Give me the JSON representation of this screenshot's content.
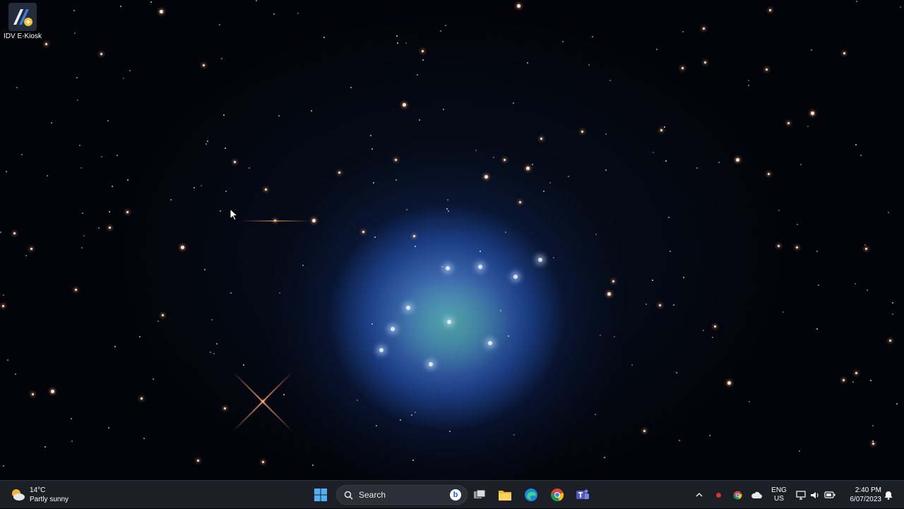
{
  "desktop": {
    "icons": [
      {
        "label": "IDV E-Kiosk",
        "icon": "idv-ekiosk-app-icon"
      }
    ]
  },
  "taskbar": {
    "weather": {
      "temperature": "14°C",
      "condition": "Partly sunny",
      "icon": "partly-sunny-icon"
    },
    "start_icon": "windows-start-icon",
    "search": {
      "label": "Search",
      "icon": "search-icon",
      "bing_icon": "bing-icon"
    },
    "pinned": [
      {
        "name": "task-view-icon"
      },
      {
        "name": "file-explorer-icon"
      },
      {
        "name": "edge-icon"
      },
      {
        "name": "chrome-icon"
      },
      {
        "name": "teams-icon"
      }
    ],
    "tray": {
      "chevron_icon": "chevron-up-icon",
      "language_line1": "ENG",
      "language_line2": "US",
      "time": "2:40 PM",
      "date": "6/07/2023"
    }
  },
  "colors": {
    "taskbar_bg": "#1c1f26",
    "nebula_blue": "#6ea8f0",
    "nebula_green": "#3caa78"
  }
}
